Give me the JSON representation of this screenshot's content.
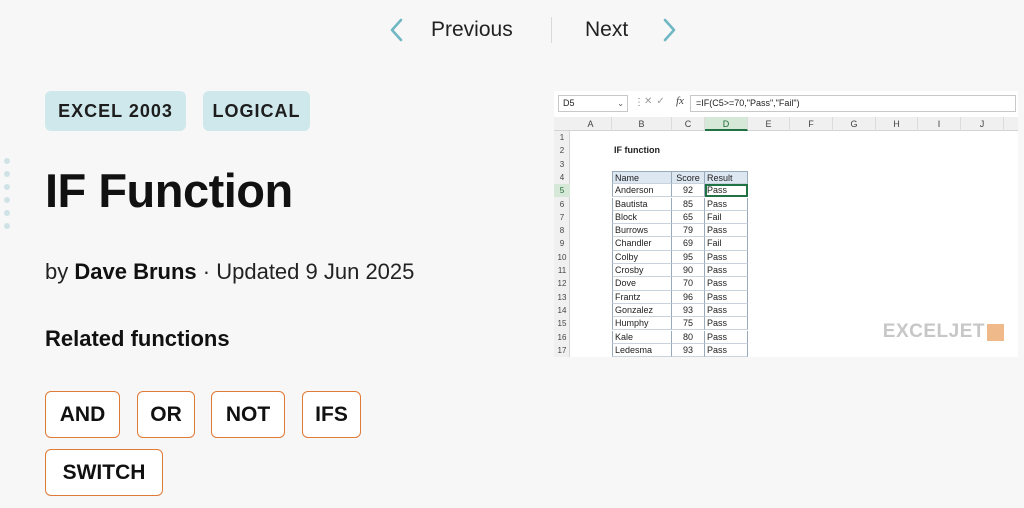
{
  "nav": {
    "previous_label": "Previous",
    "next_label": "Next",
    "chevron_color": "#6fb7c3"
  },
  "tags": [
    "EXCEL 2003",
    "LOGICAL"
  ],
  "title": "IF Function",
  "byline": {
    "prefix": "by",
    "author": "Dave Bruns",
    "updated": "· Updated 9 Jun 2025"
  },
  "related": {
    "heading": "Related functions",
    "items": [
      "AND",
      "OR",
      "NOT",
      "IFS",
      "SWITCH"
    ]
  },
  "colors": {
    "tag_bg": "#cfe8ec",
    "button_border": "#e07a36",
    "page_bg": "#f7f7f7"
  },
  "spreadsheet": {
    "name_box": "D5",
    "formula": "=IF(C5>=70,\"Pass\",\"Fail\")",
    "columns": [
      "A",
      "B",
      "C",
      "D",
      "E",
      "F",
      "G",
      "H",
      "I",
      "J"
    ],
    "rows": [
      "1",
      "2",
      "3",
      "4",
      "5",
      "6",
      "7",
      "8",
      "9",
      "10",
      "11",
      "12",
      "13",
      "14",
      "15",
      "16",
      "17"
    ],
    "sheet_title": "IF function",
    "headers": [
      "Name",
      "Score",
      "Result"
    ],
    "data": [
      [
        "Anderson",
        "92",
        "Pass"
      ],
      [
        "Bautista",
        "85",
        "Pass"
      ],
      [
        "Block",
        "65",
        "Fail"
      ],
      [
        "Burrows",
        "79",
        "Pass"
      ],
      [
        "Chandler",
        "69",
        "Fail"
      ],
      [
        "Colby",
        "95",
        "Pass"
      ],
      [
        "Crosby",
        "90",
        "Pass"
      ],
      [
        "Dove",
        "70",
        "Pass"
      ],
      [
        "Frantz",
        "96",
        "Pass"
      ],
      [
        "Gonzalez",
        "93",
        "Pass"
      ],
      [
        "Humphy",
        "75",
        "Pass"
      ],
      [
        "Kale",
        "80",
        "Pass"
      ],
      [
        "Ledesma",
        "93",
        "Pass"
      ]
    ],
    "watermark": "EXCELJET"
  }
}
